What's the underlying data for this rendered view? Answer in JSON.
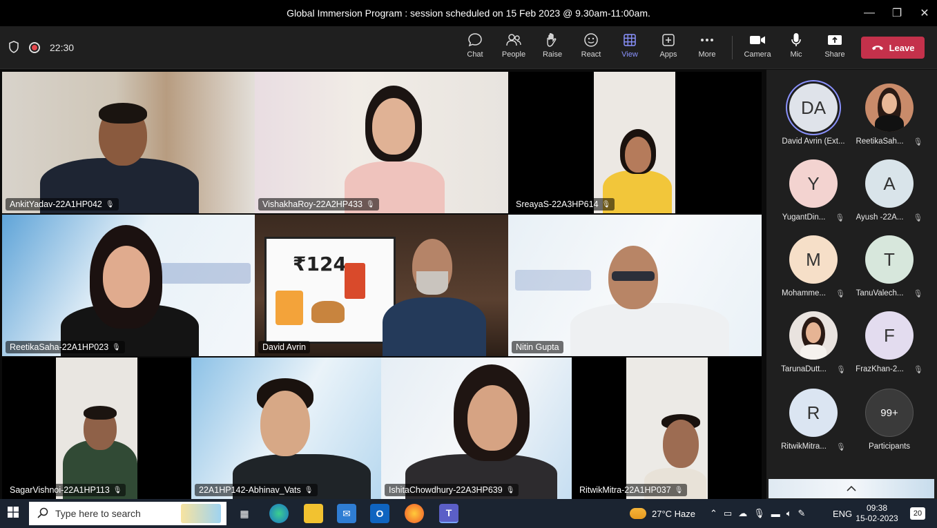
{
  "window": {
    "title": "Global Immersion Program : session scheduled on 15 Feb 2023 @ 9.30am-11:00am.",
    "minimize": "—",
    "maximize": "❐",
    "close": "✕"
  },
  "toolbar": {
    "timer": "22:30",
    "buttons": [
      {
        "label": "Chat",
        "icon": "chat-icon"
      },
      {
        "label": "People",
        "icon": "people-icon"
      },
      {
        "label": "Raise",
        "icon": "raise-hand-icon"
      },
      {
        "label": "React",
        "icon": "react-icon"
      },
      {
        "label": "View",
        "icon": "grid-view-icon"
      },
      {
        "label": "Apps",
        "icon": "apps-icon"
      },
      {
        "label": "More",
        "icon": "more-icon"
      },
      {
        "label": "Camera",
        "icon": "camera-icon"
      },
      {
        "label": "Mic",
        "icon": "mic-icon"
      },
      {
        "label": "Share",
        "icon": "share-icon"
      }
    ],
    "leave_label": "Leave"
  },
  "tiles": [
    {
      "name": "AnkitYadav-22A1HP042",
      "muted": true
    },
    {
      "name": "VishakhaRoy-22A2HP433",
      "muted": true
    },
    {
      "name": "SreayaS-22A3HP614",
      "muted": true
    },
    {
      "name": "ReetikaSaha-22A1HP023",
      "muted": true
    },
    {
      "name": "David Avrin",
      "muted": false,
      "screen_text": "₹124"
    },
    {
      "name": "Nitin Gupta",
      "muted": false
    },
    {
      "name": "SagarVishnoi-22A1HP113",
      "muted": true
    },
    {
      "name": "22A1HP142-Abhinav_Vats",
      "muted": true
    },
    {
      "name": "IshitaChowdhury-22A3HP639",
      "muted": true
    },
    {
      "name": "RitwikMitra-22A1HP037",
      "muted": true
    }
  ],
  "sidebar": {
    "participants": [
      {
        "initials": "DA",
        "name": "David Avrin (Ext...",
        "muted": false,
        "color": "#dfe3ea"
      },
      {
        "initials": "",
        "name": "ReetikaSah...",
        "muted": true,
        "color": "#c98b6a"
      },
      {
        "initials": "Y",
        "name": "YugantDin...",
        "muted": true,
        "color": "#f3d3d0"
      },
      {
        "initials": "A",
        "name": "Ayush -22A...",
        "muted": true,
        "color": "#d9e4ea"
      },
      {
        "initials": "M",
        "name": "Mohamme...",
        "muted": true,
        "color": "#f6dfc8"
      },
      {
        "initials": "T",
        "name": "TanuValech...",
        "muted": true,
        "color": "#d7e7dc"
      },
      {
        "initials": "",
        "name": "TarunaDutt...",
        "muted": true,
        "color": "#e9e3df"
      },
      {
        "initials": "F",
        "name": "FrazKhan-2...",
        "muted": true,
        "color": "#e3dcef"
      },
      {
        "initials": "R",
        "name": "RitwikMitra...",
        "muted": true,
        "color": "#dbe5f2"
      },
      {
        "initials": "99+",
        "name": "Participants",
        "muted": false,
        "color": "#3a3a3a"
      }
    ]
  },
  "taskbar": {
    "search_placeholder": "Type here to search",
    "weather": "27°C  Haze",
    "language": "ENG",
    "time": "09:38",
    "date": "15-02-2023",
    "notifications": "20"
  }
}
